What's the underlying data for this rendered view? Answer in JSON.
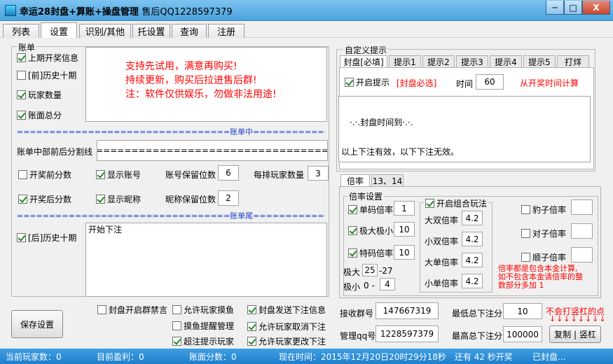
{
  "window": {
    "title_bold": "幸运28封盘+算账+操盘管理",
    "title_suffix": "售后QQ1228597379",
    "minimize": "─",
    "maximize": "□",
    "close": "X"
  },
  "tabs": [
    "列表",
    "设置",
    "识别/其他",
    "托设置",
    "查询",
    "注册"
  ],
  "bill": {
    "legend": "账单",
    "options": {
      "last_draw_info": "上期开奖信息",
      "prev_history_ten": "[前]历史十期",
      "player_count": "玩家数量",
      "bill_total_score": "账面总分"
    },
    "promo_lines": [
      "支持先试用，满意再购买!",
      "持续更新，购买后拉进售后群!",
      "注：软件仅供娱乐，勿做非法用途!"
    ],
    "middle_divider": "=================================账单中",
    "middle_divider_right": "=================================",
    "middle_split_label": "账单中部前后分割线",
    "middle_split_value": "=====================================",
    "pre_draw_score": "开奖前分数",
    "show_account": "显示账号",
    "account_digits_label": "账号保留位数",
    "account_digits_value": "6",
    "players_per_row_label": "每排玩家数量",
    "players_per_row_value": "3",
    "post_draw_score": "开奖后分数",
    "show_nickname": "显示昵称",
    "nickname_digits_label": "昵称保留位数",
    "nickname_digits_value": "2",
    "tail_divider": "=================================账单尾",
    "tail_divider_right": "=================================",
    "post_history_ten": "[后]历史十期",
    "tail_text": "开始下注"
  },
  "custom_prompt": {
    "legend": "自定义提示",
    "tabs": [
      "封盘[必填]",
      "提示1",
      "提示2",
      "提示3",
      "提示4",
      "提示5",
      "打烊"
    ],
    "enable_label": "开启提示",
    "required_note": "[封盘必选]",
    "time_label": "时间",
    "time_value": "60",
    "time_note": "从开奖时间计算",
    "message_lines": [
      "·.·.封盘时间到·.·.",
      "以上下注有效，以下下注无效。"
    ]
  },
  "odds": {
    "tabs": [
      "倍率",
      "13、14"
    ],
    "legend": "倍率设置",
    "single_code": "单码倍率",
    "single_code_value": "1",
    "extreme": "极大极小",
    "extreme_value": "10",
    "special_code": "特码倍率",
    "special_code_value": "10",
    "extreme_big_label": "极大",
    "extreme_big_value": "25",
    "extreme_big_range": "-27",
    "extreme_small_label": "极小",
    "extreme_small_prefix": "0 -",
    "extreme_small_value": "4",
    "combo_legend": "开启组合玩法",
    "combo_items": [
      {
        "label": "大双倍率",
        "value": "4.2"
      },
      {
        "label": "小双倍率",
        "value": "4.2"
      },
      {
        "label": "大单倍率",
        "value": "4.2"
      },
      {
        "label": "小单倍率",
        "value": "4.2"
      }
    ],
    "leopard": "豹子倍率",
    "pair": "对子倍率",
    "straight": "顺子倍率",
    "note_lines": [
      "倍率都是包含本金计算,",
      "如不包含本金请倍率的整",
      "数部分多加 1"
    ]
  },
  "bottom": {
    "save_button": "保存设置",
    "opt_close_mute": "封盘开启群禁言",
    "opt_allow_touch": "允许玩家摸鱼",
    "opt_send_bet_info": "封盘发送下注信息",
    "opt_touch_manage": "摸鱼提醒管理",
    "opt_allow_cancel": "允许玩家取消下注",
    "opt_over_notice": "超注提示玩家",
    "opt_allow_modify": "允许玩家更改下注",
    "group_no_label": "接收群号",
    "group_no_value": "147667319",
    "manager_qq_label": "管理qq号",
    "manager_qq_value": "1228597379",
    "min_bet_label": "最低总下注分",
    "min_bet_value": "10",
    "max_bet_label": "最高总下注分",
    "max_bet_value": "100000",
    "vertical_note": "不会打竖杠的点",
    "copy_button": "复制 | 竖杠"
  },
  "status": {
    "players": "当前玩家数：0",
    "profit": "目前盈利：0",
    "bill_score": "账面分数：0",
    "time": "现在时间：2015年12月20日20时29分18秒　还有 42 秒开奖",
    "state": "已封盘..."
  }
}
